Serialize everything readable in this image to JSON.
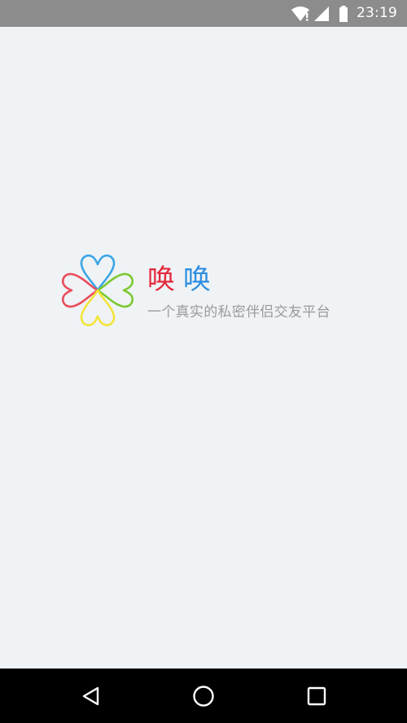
{
  "status_bar": {
    "time": "23:19",
    "icons": [
      "wifi-icon",
      "signal-icon",
      "battery-icon"
    ]
  },
  "splash": {
    "app_name_char1": "唤",
    "app_name_char2": "唤",
    "tagline": "一个真实的私密伴侣交友平台",
    "logo": "four-heart-clover-logo",
    "colors": {
      "background": "#eff3f6",
      "name_char1": "#e5293d",
      "name_char2": "#2f8fe0",
      "tagline": "#9a9a9a",
      "heart_top": "#3ea6e6",
      "heart_left": "#e94d5c",
      "heart_right": "#7cc832",
      "heart_bottom": "#f3e43a"
    }
  },
  "nav_bar": {
    "buttons": [
      "back-icon",
      "home-icon",
      "recents-icon"
    ]
  }
}
